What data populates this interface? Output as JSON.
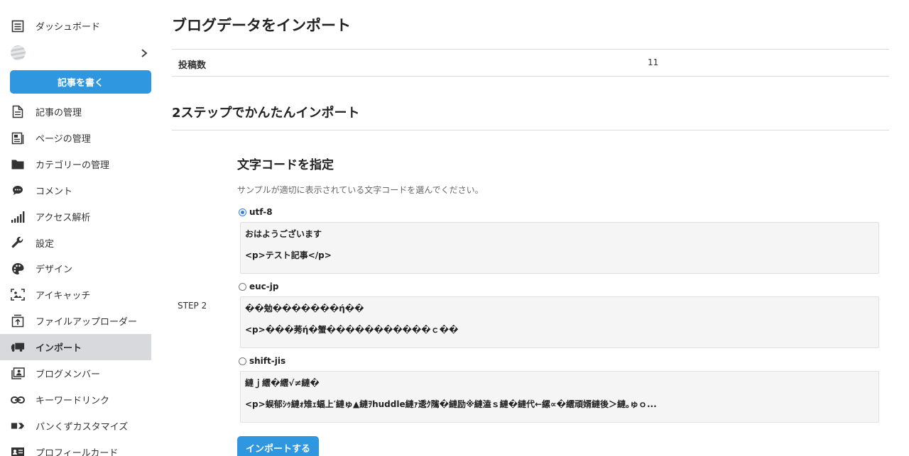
{
  "sidebar": {
    "dashboard": "ダッシュボード",
    "write_button": "記事を書く",
    "items": [
      {
        "label": "記事の管理"
      },
      {
        "label": "ページの管理"
      },
      {
        "label": "カテゴリーの管理"
      },
      {
        "label": "コメント"
      },
      {
        "label": "アクセス解析"
      },
      {
        "label": "設定"
      },
      {
        "label": "デザイン"
      },
      {
        "label": "アイキャッチ"
      },
      {
        "label": "ファイルアップローダー"
      },
      {
        "label": "インポート",
        "active": true
      },
      {
        "label": "ブログメンバー"
      },
      {
        "label": "キーワードリンク"
      },
      {
        "label": "パンくずカスタマイズ"
      },
      {
        "label": "プロフィールカード"
      }
    ]
  },
  "main": {
    "title": "ブログデータをインポート",
    "stats": {
      "label": "投稿数",
      "value": "11"
    },
    "section_title": "2ステップでかんたんインポート",
    "step": {
      "label": "STEP 2",
      "title": "文字コードを指定",
      "description": "サンプルが適切に表示されている文字コードを選んでください。",
      "options": [
        {
          "name": "utf-8",
          "selected": true,
          "line1": "おはようございます",
          "line2": "<p>テスト記事</p>"
        },
        {
          "name": "euc-jp",
          "selected": false,
          "line1": "��勉�������ή��",
          "line2": "<p>���莠ή�蟹�����������ｃ��"
        },
        {
          "name": "shift-jis",
          "selected": false,
          "line1": "縺ｊ繧�繧√≠縺�",
          "line2": "<p>蜈郁ｼｩ縺ｫ雉ｪ蝠上′縺ゅ▲縺ｦhuddle縺ｧ逶ｸ隲�縺励※縺溘ｓ縺�縺代←縲∝�繧頑婿縺後＞縺｡ゅｏ..."
        }
      ],
      "import_button": "インポートする"
    }
  },
  "colors": {
    "accent": "#2f96e0",
    "active_bg": "#d7d9dc"
  }
}
